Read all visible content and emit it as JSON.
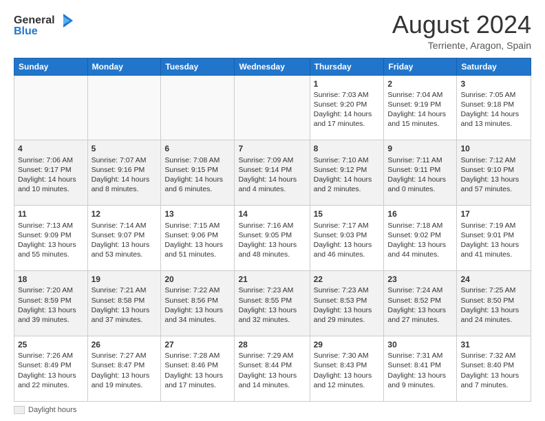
{
  "logo": {
    "line1": "General",
    "line2": "Blue"
  },
  "title": "August 2024",
  "subtitle": "Terriente, Aragon, Spain",
  "days_of_week": [
    "Sunday",
    "Monday",
    "Tuesday",
    "Wednesday",
    "Thursday",
    "Friday",
    "Saturday"
  ],
  "weeks": [
    [
      {
        "day": "",
        "info": ""
      },
      {
        "day": "",
        "info": ""
      },
      {
        "day": "",
        "info": ""
      },
      {
        "day": "",
        "info": ""
      },
      {
        "day": "1",
        "info": "Sunrise: 7:03 AM\nSunset: 9:20 PM\nDaylight: 14 hours\nand 17 minutes."
      },
      {
        "day": "2",
        "info": "Sunrise: 7:04 AM\nSunset: 9:19 PM\nDaylight: 14 hours\nand 15 minutes."
      },
      {
        "day": "3",
        "info": "Sunrise: 7:05 AM\nSunset: 9:18 PM\nDaylight: 14 hours\nand 13 minutes."
      }
    ],
    [
      {
        "day": "4",
        "info": "Sunrise: 7:06 AM\nSunset: 9:17 PM\nDaylight: 14 hours\nand 10 minutes."
      },
      {
        "day": "5",
        "info": "Sunrise: 7:07 AM\nSunset: 9:16 PM\nDaylight: 14 hours\nand 8 minutes."
      },
      {
        "day": "6",
        "info": "Sunrise: 7:08 AM\nSunset: 9:15 PM\nDaylight: 14 hours\nand 6 minutes."
      },
      {
        "day": "7",
        "info": "Sunrise: 7:09 AM\nSunset: 9:14 PM\nDaylight: 14 hours\nand 4 minutes."
      },
      {
        "day": "8",
        "info": "Sunrise: 7:10 AM\nSunset: 9:12 PM\nDaylight: 14 hours\nand 2 minutes."
      },
      {
        "day": "9",
        "info": "Sunrise: 7:11 AM\nSunset: 9:11 PM\nDaylight: 14 hours\nand 0 minutes."
      },
      {
        "day": "10",
        "info": "Sunrise: 7:12 AM\nSunset: 9:10 PM\nDaylight: 13 hours\nand 57 minutes."
      }
    ],
    [
      {
        "day": "11",
        "info": "Sunrise: 7:13 AM\nSunset: 9:09 PM\nDaylight: 13 hours\nand 55 minutes."
      },
      {
        "day": "12",
        "info": "Sunrise: 7:14 AM\nSunset: 9:07 PM\nDaylight: 13 hours\nand 53 minutes."
      },
      {
        "day": "13",
        "info": "Sunrise: 7:15 AM\nSunset: 9:06 PM\nDaylight: 13 hours\nand 51 minutes."
      },
      {
        "day": "14",
        "info": "Sunrise: 7:16 AM\nSunset: 9:05 PM\nDaylight: 13 hours\nand 48 minutes."
      },
      {
        "day": "15",
        "info": "Sunrise: 7:17 AM\nSunset: 9:03 PM\nDaylight: 13 hours\nand 46 minutes."
      },
      {
        "day": "16",
        "info": "Sunrise: 7:18 AM\nSunset: 9:02 PM\nDaylight: 13 hours\nand 44 minutes."
      },
      {
        "day": "17",
        "info": "Sunrise: 7:19 AM\nSunset: 9:01 PM\nDaylight: 13 hours\nand 41 minutes."
      }
    ],
    [
      {
        "day": "18",
        "info": "Sunrise: 7:20 AM\nSunset: 8:59 PM\nDaylight: 13 hours\nand 39 minutes."
      },
      {
        "day": "19",
        "info": "Sunrise: 7:21 AM\nSunset: 8:58 PM\nDaylight: 13 hours\nand 37 minutes."
      },
      {
        "day": "20",
        "info": "Sunrise: 7:22 AM\nSunset: 8:56 PM\nDaylight: 13 hours\nand 34 minutes."
      },
      {
        "day": "21",
        "info": "Sunrise: 7:23 AM\nSunset: 8:55 PM\nDaylight: 13 hours\nand 32 minutes."
      },
      {
        "day": "22",
        "info": "Sunrise: 7:23 AM\nSunset: 8:53 PM\nDaylight: 13 hours\nand 29 minutes."
      },
      {
        "day": "23",
        "info": "Sunrise: 7:24 AM\nSunset: 8:52 PM\nDaylight: 13 hours\nand 27 minutes."
      },
      {
        "day": "24",
        "info": "Sunrise: 7:25 AM\nSunset: 8:50 PM\nDaylight: 13 hours\nand 24 minutes."
      }
    ],
    [
      {
        "day": "25",
        "info": "Sunrise: 7:26 AM\nSunset: 8:49 PM\nDaylight: 13 hours\nand 22 minutes."
      },
      {
        "day": "26",
        "info": "Sunrise: 7:27 AM\nSunset: 8:47 PM\nDaylight: 13 hours\nand 19 minutes."
      },
      {
        "day": "27",
        "info": "Sunrise: 7:28 AM\nSunset: 8:46 PM\nDaylight: 13 hours\nand 17 minutes."
      },
      {
        "day": "28",
        "info": "Sunrise: 7:29 AM\nSunset: 8:44 PM\nDaylight: 13 hours\nand 14 minutes."
      },
      {
        "day": "29",
        "info": "Sunrise: 7:30 AM\nSunset: 8:43 PM\nDaylight: 13 hours\nand 12 minutes."
      },
      {
        "day": "30",
        "info": "Sunrise: 7:31 AM\nSunset: 8:41 PM\nDaylight: 13 hours\nand 9 minutes."
      },
      {
        "day": "31",
        "info": "Sunrise: 7:32 AM\nSunset: 8:40 PM\nDaylight: 13 hours\nand 7 minutes."
      }
    ]
  ],
  "footer": {
    "legend_label": "Daylight hours"
  }
}
